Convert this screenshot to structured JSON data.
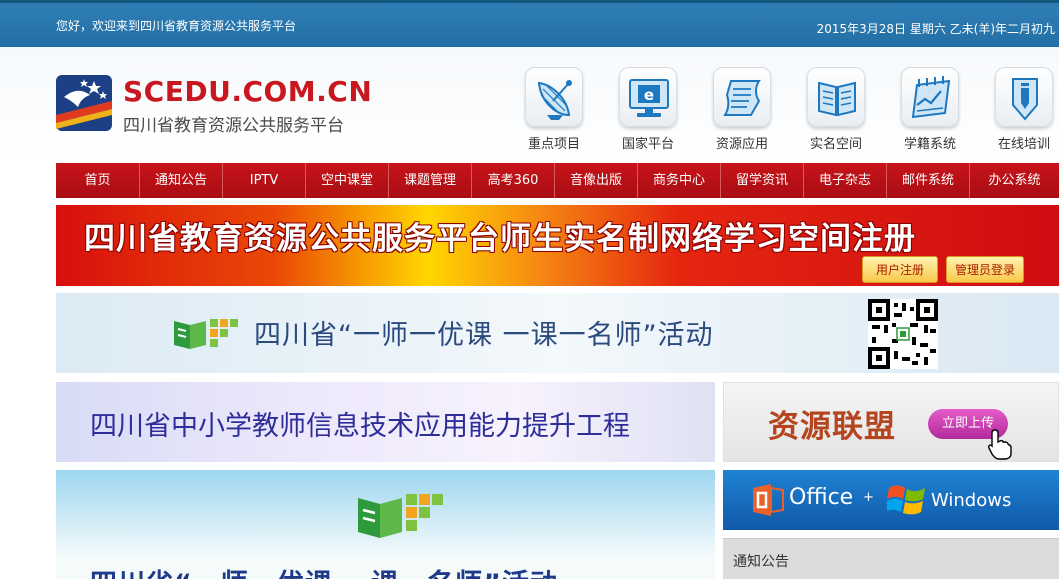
{
  "topbar": {
    "welcome": "您好，欢迎来到四川省教育资源公共服务平台",
    "date": "2015年3月28日 星期六 乙未(羊)年二月初九"
  },
  "logo": {
    "title": "SCEDU.COM.CN",
    "subtitle": "四川省教育资源公共服务平台"
  },
  "quick_links": [
    {
      "label": "重点项目",
      "icon": "satellite-dish-icon"
    },
    {
      "label": "国家平台",
      "icon": "computer-monitor-icon"
    },
    {
      "label": "资源应用",
      "icon": "scroll-document-icon"
    },
    {
      "label": "实名空间",
      "icon": "open-book-icon"
    },
    {
      "label": "学籍系统",
      "icon": "calendar-chart-icon"
    },
    {
      "label": "在线培训",
      "icon": "pencil-shield-icon"
    }
  ],
  "nav": {
    "items": [
      "首页",
      "通知公告",
      "IPTV",
      "空中课堂",
      "课题管理",
      "高考360",
      "音像出版",
      "商务中心",
      "留学资讯",
      "电子杂志",
      "邮件系统",
      "办公系统"
    ]
  },
  "banner1": {
    "title": "四川省教育资源公共服务平台师生实名制网络学习空间注册",
    "user_register": "用户注册",
    "admin_login": "管理员登录"
  },
  "banner2": {
    "title": "四川省“一师一优课 一课一名师”活动"
  },
  "banner3": {
    "title": "四川省中小学教师信息技术应用能力提升工程"
  },
  "side_resource": {
    "title": "资源联盟",
    "upload_button": "立即上传"
  },
  "banner4": {
    "title": "四川省“一师一优课 一课一名师”活动"
  },
  "side_office": {
    "office": "Office",
    "plus": "+",
    "windows": "Windows"
  },
  "notice": {
    "title": "通知公告"
  },
  "colors": {
    "topbar": "#2a78b0",
    "nav": "#b81016",
    "brand_red": "#c8171e"
  }
}
